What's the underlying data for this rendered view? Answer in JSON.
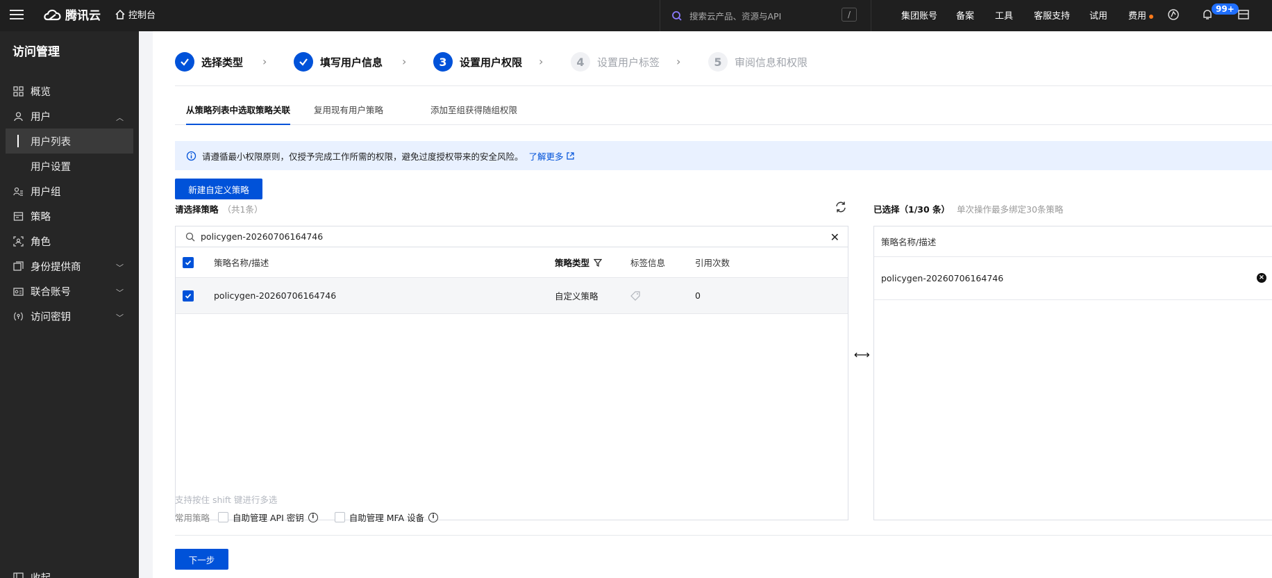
{
  "topbar": {
    "brand": "腾讯云",
    "console": "控制台",
    "search_placeholder": "搜索云产品、资源与API",
    "search_shortcut": "/",
    "nav": [
      "集团账号",
      "备案",
      "工具",
      "客服支持",
      "试用",
      "费用"
    ],
    "notification_badge": "99+"
  },
  "sidebar": {
    "title": "访问管理",
    "items": [
      {
        "label": "概览"
      },
      {
        "label": "用户"
      },
      {
        "label": "用户列表"
      },
      {
        "label": "用户设置"
      },
      {
        "label": "用户组"
      },
      {
        "label": "策略"
      },
      {
        "label": "角色"
      },
      {
        "label": "身份提供商"
      },
      {
        "label": "联合账号"
      },
      {
        "label": "访问密钥"
      }
    ],
    "collapse": "收起"
  },
  "steps": [
    {
      "num": "✓",
      "label": "选择类型"
    },
    {
      "num": "✓",
      "label": "填写用户信息"
    },
    {
      "num": "3",
      "label": "设置用户权限"
    },
    {
      "num": "4",
      "label": "设置用户标签"
    },
    {
      "num": "5",
      "label": "审阅信息和权限"
    }
  ],
  "tabs": [
    "从策略列表中选取策略关联",
    "复用现有用户策略",
    "添加至组获得随组权限"
  ],
  "notice": {
    "text": "请遵循最小权限原则，仅授予完成工作所需的权限，避免过度授权带来的安全风险。",
    "link": "了解更多"
  },
  "create_policy_button": "新建自定义策略",
  "left": {
    "title": "请选择策略",
    "count": "（共1条）",
    "search_value": "policygen-20260706164746",
    "columns": [
      "策略名称/描述",
      "策略类型",
      "标签信息",
      "引用次数"
    ],
    "rows": [
      {
        "name": "policygen-20260706164746",
        "type": "自定义策略",
        "refs": "0"
      }
    ]
  },
  "right": {
    "title": "已选择（1/30 条）",
    "hint": "单次操作最多绑定30条策略",
    "column": "策略名称/描述",
    "selected": [
      "policygen-20260706164746"
    ]
  },
  "tip": "支持按住 shift 键进行多选",
  "common": {
    "label": "常用策略",
    "options": [
      "自助管理 API 密钥",
      "自助管理 MFA 设备"
    ]
  },
  "next_button": "下一步",
  "colors": {
    "primary": "#0052d9",
    "topbar": "#1f1f1f",
    "sidebar": "#262626",
    "notice_bg": "#e9f1ff"
  }
}
